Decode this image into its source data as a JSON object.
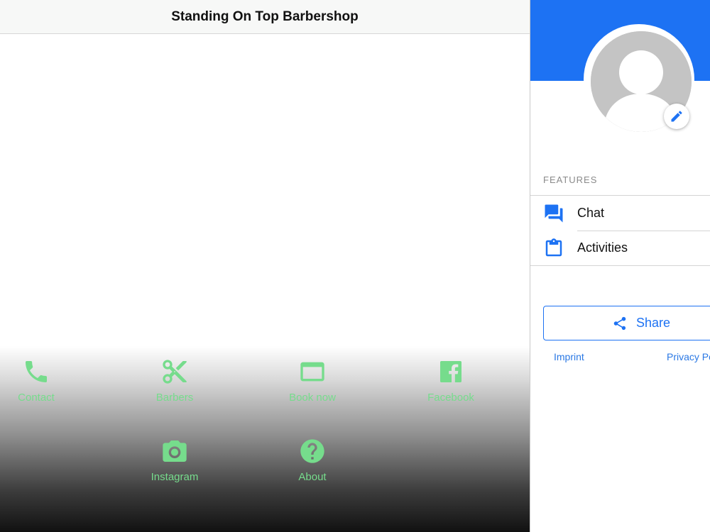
{
  "app": {
    "title": "Standing On Top Barbershop",
    "label_color": "#76dc8c",
    "nav_items": [
      {
        "label": "Contact",
        "icon": "phone-icon"
      },
      {
        "label": "Barbers",
        "icon": "scissors-icon"
      },
      {
        "label": "Book now",
        "icon": "browser-window-icon"
      },
      {
        "label": "Facebook",
        "icon": "facebook-icon"
      },
      {
        "label": "Instagram",
        "icon": "camera-icon"
      },
      {
        "label": "About",
        "icon": "help-circle-icon"
      }
    ]
  },
  "drawer": {
    "accent_color": "#1d72f3",
    "avatar_icon": "avatar-placeholder-icon",
    "edit_icon": "pencil-icon",
    "features_header": "FEATURES",
    "features": [
      {
        "label": "Chat",
        "icon": "chat-bubbles-icon"
      },
      {
        "label": "Activities",
        "icon": "clipboard-icon"
      }
    ],
    "share_label": "Share",
    "share_icon": "share-icon",
    "footer": {
      "imprint": "Imprint",
      "privacy": "Privacy Po"
    }
  }
}
